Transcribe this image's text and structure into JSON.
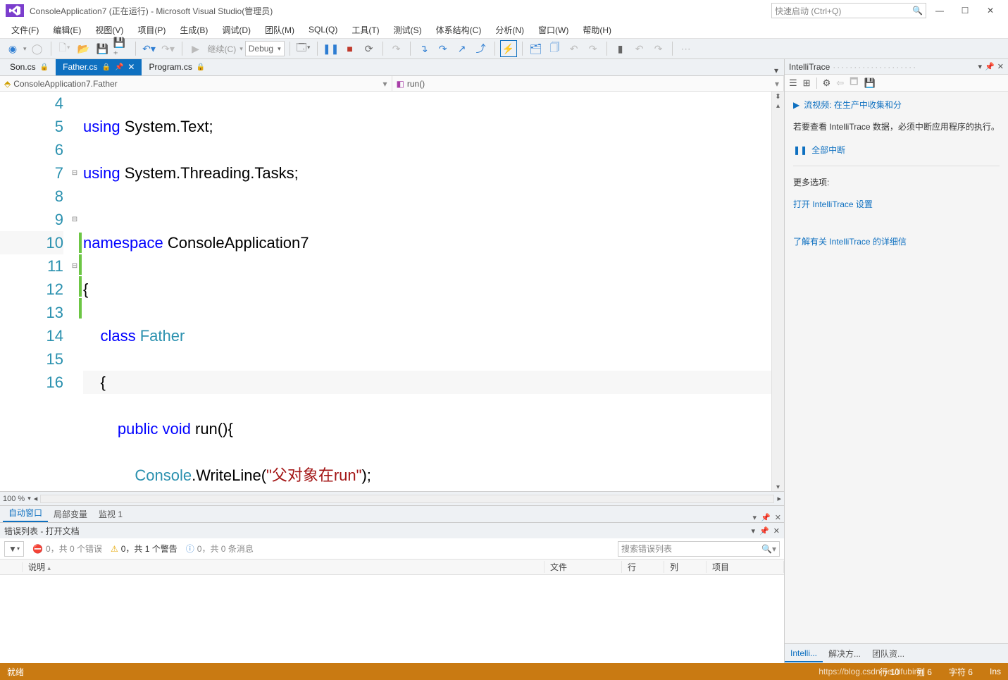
{
  "title_bar": {
    "title": "ConsoleApplication7 (正在运行) - Microsoft Visual Studio(管理员)",
    "quick_launch_placeholder": "快速启动 (Ctrl+Q)"
  },
  "menu": {
    "file": "文件(F)",
    "edit": "编辑(E)",
    "view": "视图(V)",
    "project": "项目(P)",
    "build": "生成(B)",
    "debug": "调试(D)",
    "team": "团队(M)",
    "sql": "SQL(Q)",
    "tools": "工具(T)",
    "test": "测试(S)",
    "arch": "体系结构(C)",
    "analyze": "分析(N)",
    "window": "窗口(W)",
    "help": "帮助(H)"
  },
  "toolbar": {
    "continue_label": "继续(C)",
    "config": "Debug"
  },
  "doc_tabs": [
    {
      "label": "Son.cs",
      "active": false
    },
    {
      "label": "Father.cs",
      "active": true
    },
    {
      "label": "Program.cs",
      "active": false
    }
  ],
  "nav": {
    "class": "ConsoleApplication7.Father",
    "member": "run()"
  },
  "code": {
    "line_numbers": [
      "4",
      "5",
      "6",
      "7",
      "8",
      "9",
      "10",
      "11",
      "12",
      "13",
      "14",
      "15",
      "16"
    ],
    "lines": {
      "l4_pre": "using",
      "l4_rest": " System.Text;",
      "l5_pre": "using",
      "l5_rest": " System.Threading.Tasks;",
      "l6": "",
      "l7_pre": "namespace",
      "l7_rest": " ConsoleApplication7",
      "l8": "{",
      "l9_pre": "    class",
      "l9_type": " Father",
      "l10": "    {",
      "l11_pre": "        public",
      "l11_kw2": " void",
      "l11_rest": " run(){",
      "l12_pre": "            Console",
      "l12_mid": ".WriteLine(",
      "l12_str": "\"父对象在run\"",
      "l12_end": ");",
      "l13": "        }",
      "l14": "    }",
      "l15": "}",
      "l16": ""
    }
  },
  "zoom": {
    "level": "100 %"
  },
  "bottom_tabs": {
    "auto": "自动窗口",
    "locals": "局部变量",
    "watch": "监视 1"
  },
  "error_panel": {
    "title": "错误列表 - 打开文档",
    "errors": "0，共 0 个错误",
    "warnings": "0，共 1 个警告",
    "messages": "0，共 0 条消息",
    "search_placeholder": "搜索错误列表",
    "cols": {
      "desc": "说明",
      "file": "文件",
      "line": "行",
      "col": "列",
      "project": "项目"
    }
  },
  "intellitrace": {
    "title": "IntelliTrace",
    "video_text": "流视频: 在生产中收集和分",
    "hint": "若要查看 IntelliTrace 数据，必须中断应用程序的执行。",
    "break_all": "全部中断",
    "more_title": "更多选项:",
    "open_settings": "打开 IntelliTrace 设置",
    "learn_more": "了解有关 IntelliTrace 的详细信",
    "tabs": {
      "intelli": "Intelli...",
      "solution": "解决方...",
      "team": "团队资..."
    }
  },
  "status": {
    "ready": "就绪",
    "line": "行 10",
    "col": "列 6",
    "char": "字符 6",
    "ins": "Ins",
    "watermark": "https://blog.csdn.net/lifubing"
  },
  "colors": {
    "accent": "#0e70c0",
    "status_bg": "#c97a12"
  }
}
